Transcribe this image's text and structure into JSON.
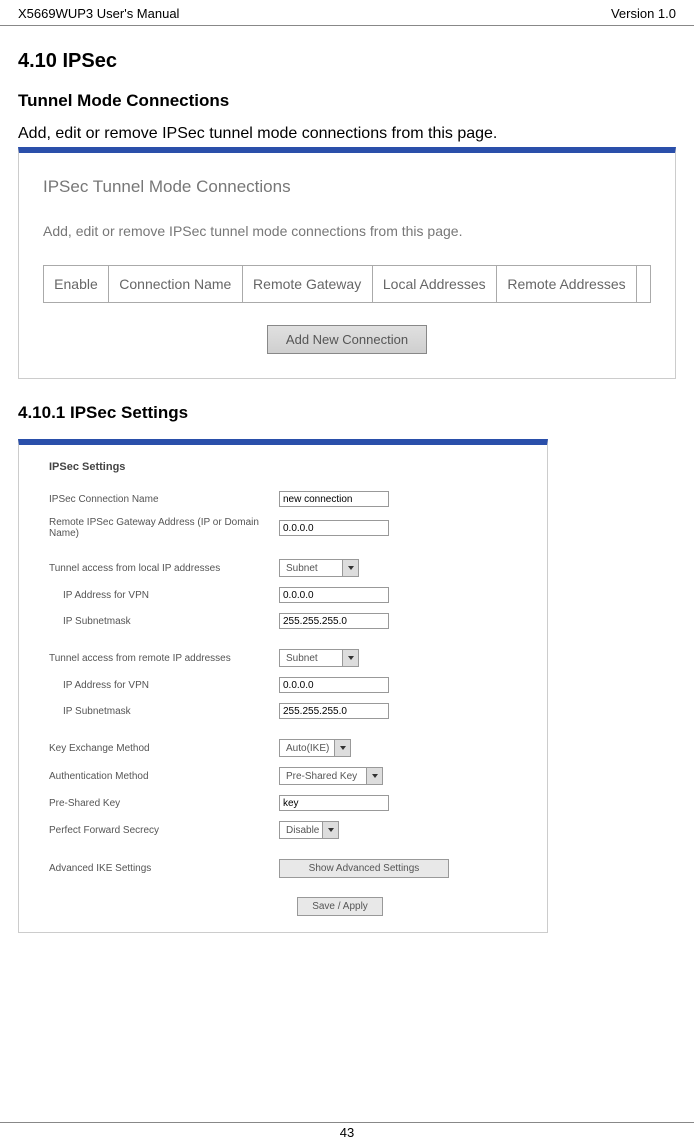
{
  "header": {
    "left": "X5669WUP3 User's Manual",
    "right": "Version 1.0"
  },
  "section": {
    "title": "4.10 IPSec",
    "subtitle": "Tunnel Mode Connections",
    "intro": "Add, edit or remove IPSec tunnel mode connections from this page."
  },
  "panel_top": {
    "title": "IPSec Tunnel Mode Connections",
    "desc": "Add, edit or remove IPSec tunnel mode connections from this page.",
    "columns": [
      "Enable",
      "Connection Name",
      "Remote Gateway",
      "Local Addresses",
      "Remote Addresses"
    ],
    "button": "Add New Connection"
  },
  "subsection2": "4.10.1 IPSec Settings",
  "settings": {
    "title": "IPSec Settings",
    "rows": {
      "conn_name_label": "IPSec Connection Name",
      "conn_name_value": "new connection",
      "remote_gw_label": "Remote IPSec Gateway Address (IP or Domain Name)",
      "remote_gw_value": "0.0.0.0",
      "tun_local_label": "Tunnel access from local IP addresses",
      "tun_local_value": "Subnet",
      "ip_vpn_label": "IP Address for VPN",
      "ip_vpn_local_value": "0.0.0.0",
      "subnet_label": "IP Subnetmask",
      "subnet_local_value": "255.255.255.0",
      "tun_remote_label": "Tunnel access from remote IP addresses",
      "tun_remote_value": "Subnet",
      "ip_vpn_remote_value": "0.0.0.0",
      "subnet_remote_value": "255.255.255.0",
      "key_ex_label": "Key Exchange Method",
      "key_ex_value": "Auto(IKE)",
      "auth_label": "Authentication Method",
      "auth_value": "Pre-Shared Key",
      "psk_label": "Pre-Shared Key",
      "psk_value": "key",
      "pfs_label": "Perfect Forward Secrecy",
      "pfs_value": "Disable",
      "adv_label": "Advanced IKE Settings",
      "adv_button": "Show Advanced Settings",
      "save_button": "Save / Apply"
    }
  },
  "footer": {
    "page_number": "43"
  }
}
